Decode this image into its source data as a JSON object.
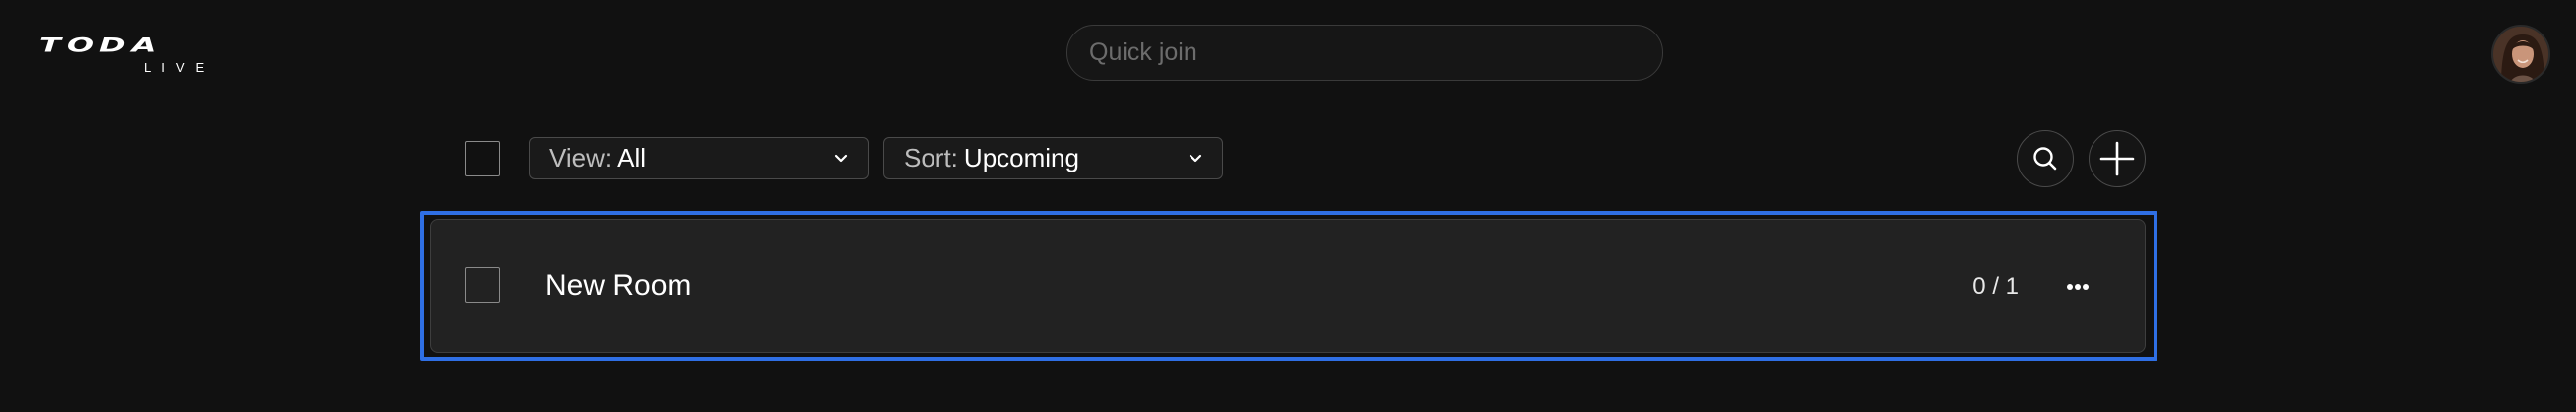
{
  "header": {
    "logo_main": "TODA",
    "logo_sub": "LIVE",
    "quick_join_placeholder": "Quick join",
    "quick_join_value": "",
    "avatar_icon": "user-avatar-photo"
  },
  "toolbar": {
    "view_prefix": "View:",
    "view_value": "All",
    "sort_prefix": "Sort:",
    "sort_value": "Upcoming",
    "search_icon": "search-icon",
    "add_icon": "plus-icon"
  },
  "rooms": [
    {
      "name": "New Room",
      "count": "0 / 1",
      "menu_icon": "more-horizontal-icon"
    }
  ],
  "colors": {
    "background": "#111111",
    "card": "#222222",
    "focus": "#2f6fe4"
  }
}
